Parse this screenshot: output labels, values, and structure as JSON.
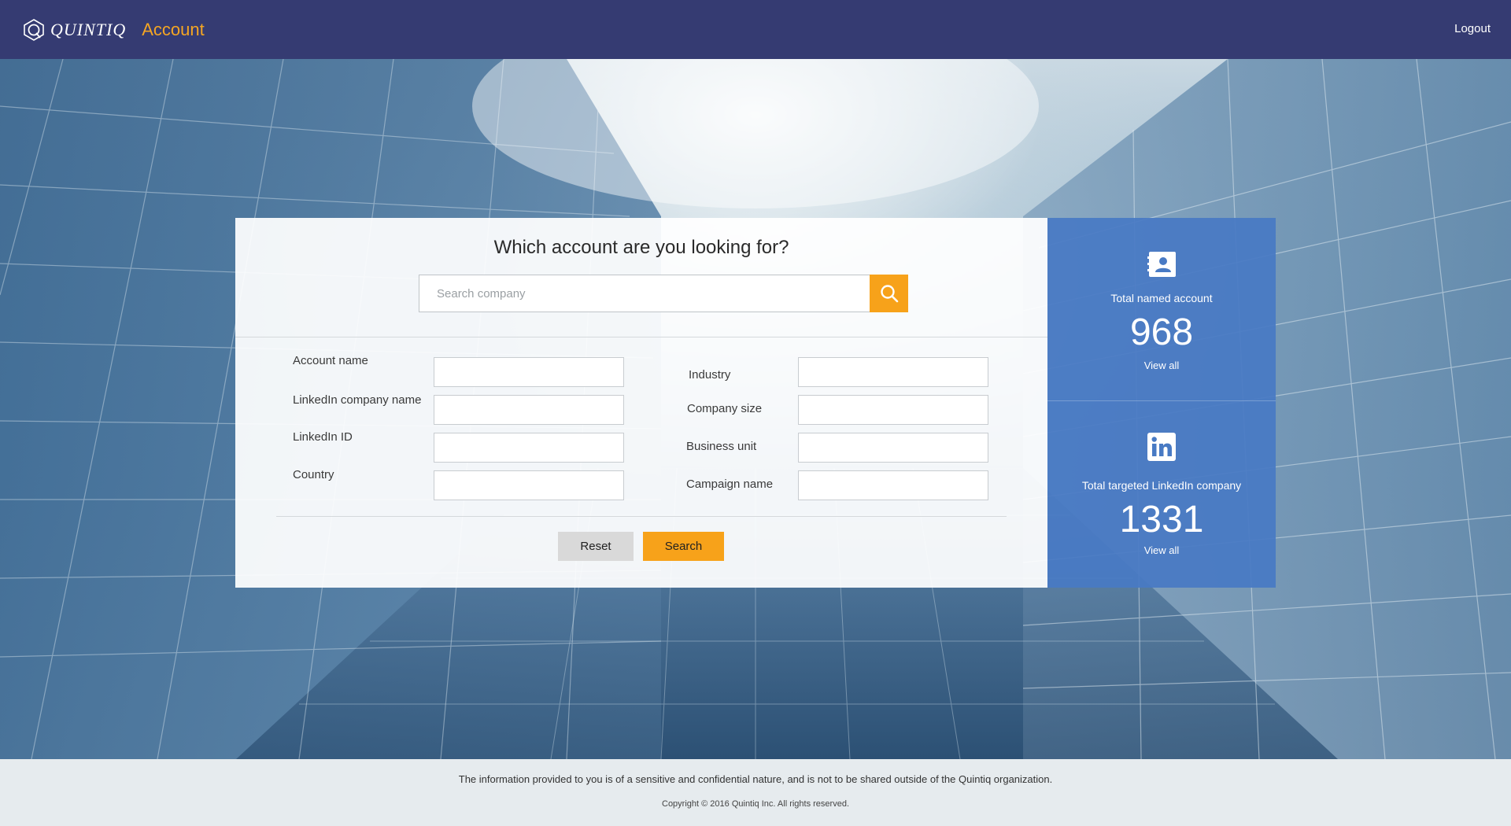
{
  "header": {
    "brand_name": "QUINTIQ",
    "section": "Account",
    "logout_label": "Logout"
  },
  "search_card": {
    "title": "Which account are you looking for?",
    "search_placeholder": "Search company",
    "fields_left": [
      {
        "label": "Account name",
        "value": ""
      },
      {
        "label": "LinkedIn company name",
        "value": ""
      },
      {
        "label": "LinkedIn ID",
        "value": ""
      },
      {
        "label": "Country",
        "value": ""
      }
    ],
    "fields_right": [
      {
        "label": "Industry",
        "value": ""
      },
      {
        "label": "Company size",
        "value": ""
      },
      {
        "label": "Business unit",
        "value": ""
      },
      {
        "label": "Campaign name",
        "value": ""
      }
    ],
    "reset_label": "Reset",
    "search_label": "Search"
  },
  "stats": {
    "named": {
      "icon": "contact-card-icon",
      "label": "Total named account",
      "value": "968",
      "link": "View all"
    },
    "linkedin": {
      "icon": "linkedin-icon",
      "label": "Total targeted LinkedIn company",
      "value": "1331",
      "link": "View all"
    }
  },
  "footer": {
    "note": "The information provided to you is of a sensitive and confidential nature, and is not to be shared outside of the Quintiq organization.",
    "copyright": "Copyright © 2016 Quintiq Inc. All rights reserved."
  },
  "colors": {
    "header_bg": "#353b72",
    "accent": "#f7a21a",
    "stats_bg": "#487ac4",
    "footer_bg": "#e6ebee"
  }
}
